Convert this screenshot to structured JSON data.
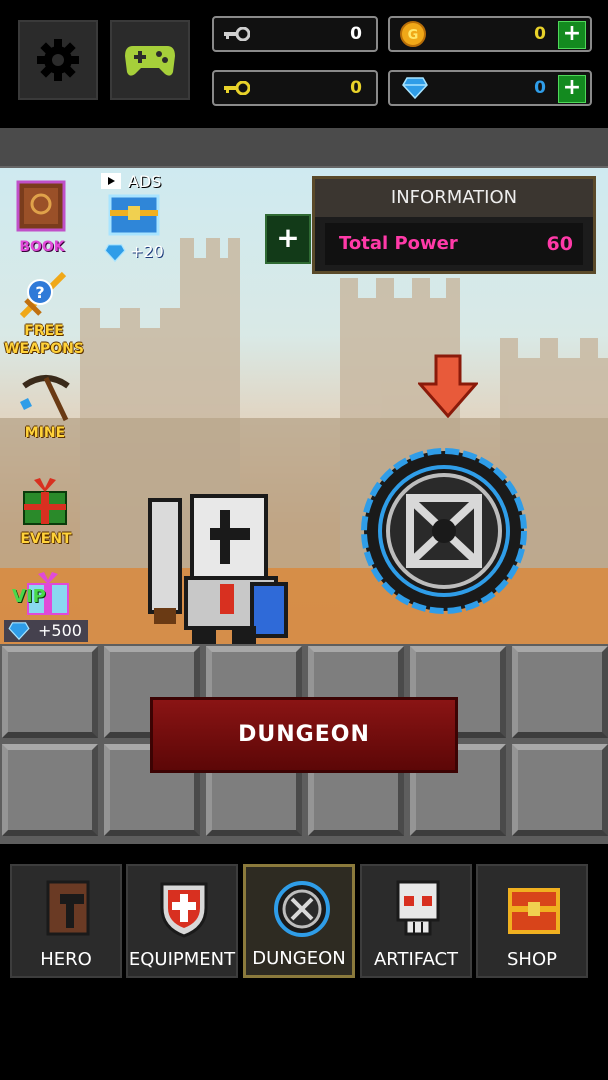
{
  "top": {
    "resources": {
      "silver_keys": "0",
      "gold_keys": "0",
      "gold": "0",
      "gems": "0"
    }
  },
  "side": {
    "book": "BOOK",
    "ads_label": "ADS",
    "ads_reward": "+20",
    "free_weapons": "FREE\nWEAPONS",
    "mine": "MINE",
    "event": "EVENT",
    "vip": "VIP",
    "vip_reward": "+500"
  },
  "info": {
    "title": "INFORMATION",
    "plus": "+",
    "label": "Total Power",
    "value": "60"
  },
  "main_button": "DUNGEON",
  "nav": [
    {
      "label": "HERO"
    },
    {
      "label": "EQUIPMENT"
    },
    {
      "label": "DUNGEON"
    },
    {
      "label": "ARTIFACT"
    },
    {
      "label": "SHOP"
    }
  ],
  "colors": {
    "accent_pink": "#ff3aa8",
    "dungeon_button": "#7a0f0f",
    "plus_green": "#138a1f",
    "portal_blue": "#2f9de8"
  }
}
